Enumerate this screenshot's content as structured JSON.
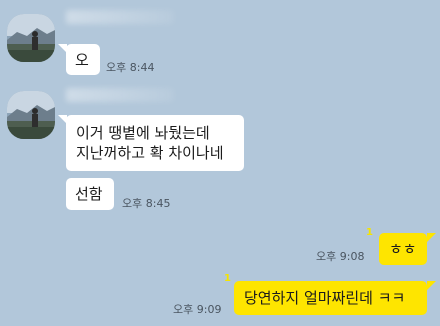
{
  "messages": [
    {
      "text": "오",
      "time": "오후 8:44"
    },
    {
      "lines": [
        "이거 땡볕에 놔뒀는데",
        "지난꺼하고 확 차이나네"
      ]
    },
    {
      "text": "선함",
      "time": "오후 8:45"
    },
    {
      "text": "ㅎㅎ",
      "time": "오후 9:08"
    },
    {
      "text": "당연하지 얼마짜린데 ㅋㅋ",
      "time": "오후 9:09"
    }
  ],
  "colors": {
    "background": "#b2c7da",
    "incoming": "#ffffff",
    "outgoing": "#fee500"
  }
}
